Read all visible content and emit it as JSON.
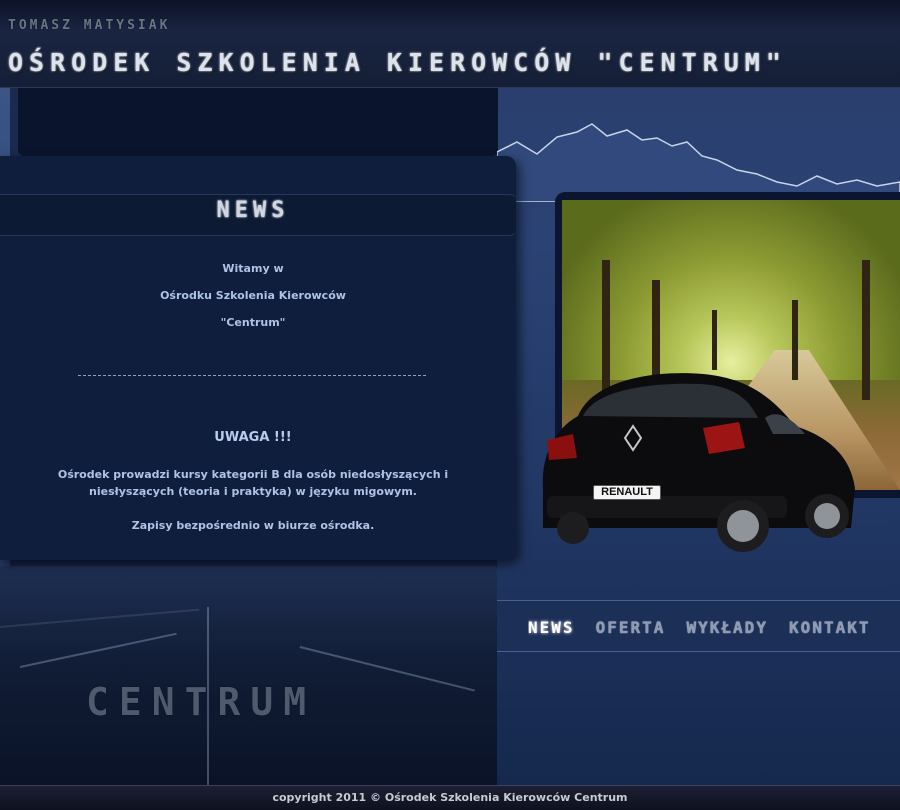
{
  "header": {
    "owner": "TOMASZ MATYSIAK",
    "title": "OŚRODEK SZKOLENIA KIEROWCÓW \"CENTRUM\""
  },
  "news": {
    "heading": "NEWS",
    "welcome": [
      "Witamy w",
      "Ośrodku Szkolenia Kierowców",
      "\"Centrum\""
    ],
    "warning_title": "UWAGA !!!",
    "warning_text": [
      "Ośrodek prowadzi kursy kategorii B dla osób niedosłyszących i",
      "niesłyszących (teoria i praktyka) w języku migowym."
    ],
    "enrollment": "Zapisy bezpośrednio w biurze ośrodka."
  },
  "nav": {
    "items": [
      "NEWS",
      "OFERTA",
      "WYKŁADY",
      "KONTAKT"
    ],
    "active": "NEWS"
  },
  "photo": {
    "plate_text": "RENAULT"
  },
  "brand": "CENTRUM",
  "footer": {
    "copyright": "copyright 2011 © Ośrodek Szkolenia Kierowców Centrum"
  },
  "colors": {
    "background": "#162648",
    "panel": "#0f1e3c",
    "text_light": "#aec3e6",
    "nav_active": "#ffffff",
    "nav_inactive": "#8e9ab3"
  }
}
